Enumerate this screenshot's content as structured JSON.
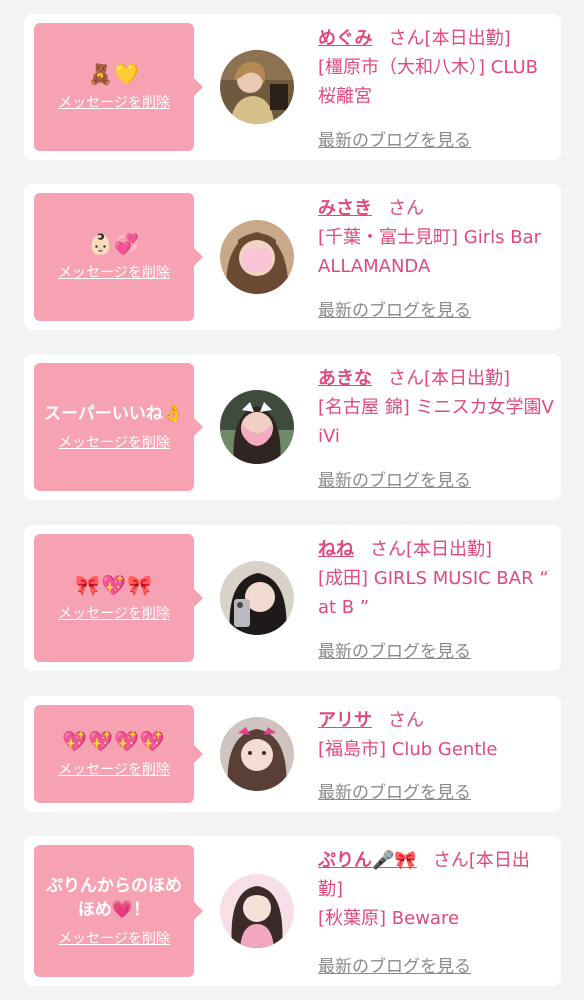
{
  "delete_label": "メッセージを削除",
  "blog_label": "最新のブログを見る",
  "honorific": "さん",
  "colors": {
    "accent": "#e04a7b",
    "bubble": "#f7a2b3",
    "link_gray": "#8a8a8a"
  },
  "items": [
    {
      "message": "🧸💛",
      "name": "めぐみ",
      "status": "[本日出勤]",
      "shop": "[橿原市（大和八木）] CLUB 桜離宮"
    },
    {
      "message": "👶🏻💞",
      "name": "みさき",
      "status": "",
      "shop": "[千葉・富士見町] Girls Bar ALLAMANDA"
    },
    {
      "message": "スーパーいいね👌",
      "name": "あきな",
      "status": "[本日出勤]",
      "shop": "[名古屋 錦] ミニスカ女学園ViVi"
    },
    {
      "message": "🎀💖🎀",
      "name": "ねね",
      "status": "[本日出勤]",
      "shop": "[成田] GIRLS MUSIC BAR “ at B ”"
    },
    {
      "message": "💖💖💖💖",
      "name": "アリサ",
      "status": "",
      "shop": "[福島市] Club Gentle"
    },
    {
      "message": "ぷりんからのほめほめ💗！",
      "name": "ぷりん🎤🎀",
      "status": "[本日出勤]",
      "shop": "[秋葉原] Beware"
    }
  ]
}
